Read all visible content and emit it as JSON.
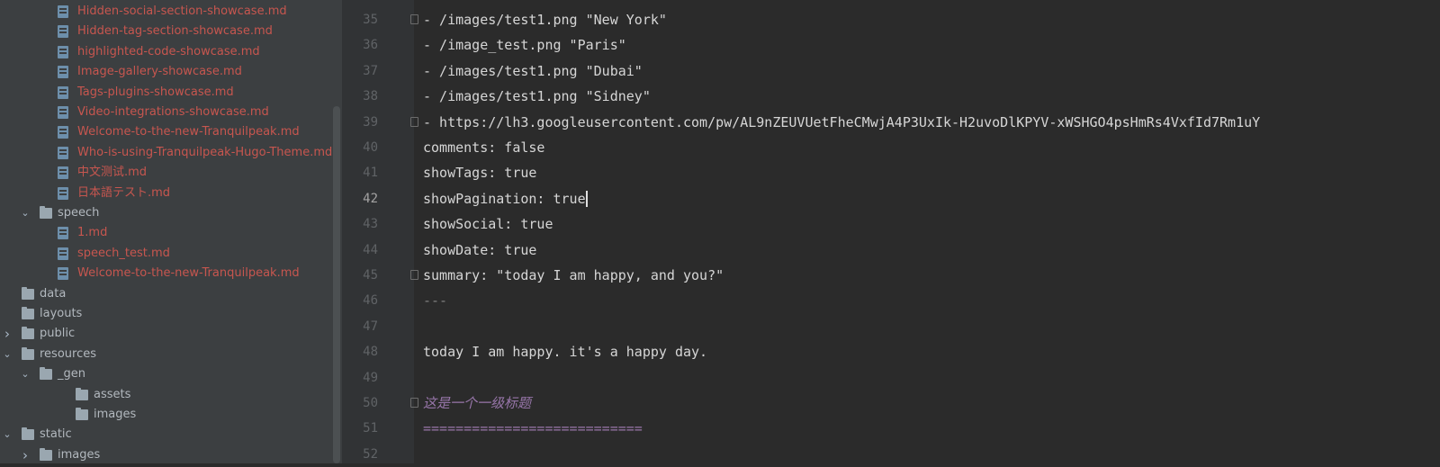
{
  "tree": {
    "items": [
      {
        "kind": "file",
        "depth": 2,
        "label": "Hidden-social-section-showcase.md"
      },
      {
        "kind": "file",
        "depth": 2,
        "label": "Hidden-tag-section-showcase.md"
      },
      {
        "kind": "file",
        "depth": 2,
        "label": "highlighted-code-showcase.md"
      },
      {
        "kind": "file",
        "depth": 2,
        "label": "Image-gallery-showcase.md"
      },
      {
        "kind": "file",
        "depth": 2,
        "label": "Tags-plugins-showcase.md"
      },
      {
        "kind": "file",
        "depth": 2,
        "label": "Video-integrations-showcase.md"
      },
      {
        "kind": "file",
        "depth": 2,
        "label": "Welcome-to-the-new-Tranquilpeak.md"
      },
      {
        "kind": "file",
        "depth": 2,
        "label": "Who-is-using-Tranquilpeak-Hugo-Theme.md"
      },
      {
        "kind": "file",
        "depth": 2,
        "label": "中文测试.md"
      },
      {
        "kind": "file",
        "depth": 2,
        "label": "日本語テスト.md"
      },
      {
        "kind": "dir",
        "depth": 1,
        "state": "expanded",
        "label": "speech"
      },
      {
        "kind": "file",
        "depth": 2,
        "label": "1.md"
      },
      {
        "kind": "file",
        "depth": 2,
        "label": "speech_test.md"
      },
      {
        "kind": "file",
        "depth": 2,
        "label": "Welcome-to-the-new-Tranquilpeak.md"
      },
      {
        "kind": "dir",
        "depth": 0,
        "state": "leaf",
        "label": "data"
      },
      {
        "kind": "dir",
        "depth": 0,
        "state": "leaf",
        "label": "layouts"
      },
      {
        "kind": "dir",
        "depth": 0,
        "state": "collapsed",
        "label": "public"
      },
      {
        "kind": "dir",
        "depth": 0,
        "state": "expanded",
        "label": "resources"
      },
      {
        "kind": "dir",
        "depth": 1,
        "state": "expanded",
        "label": "_gen"
      },
      {
        "kind": "dir",
        "depth": 2,
        "state": "leaf",
        "label": "assets"
      },
      {
        "kind": "dir",
        "depth": 2,
        "state": "leaf",
        "label": "images"
      },
      {
        "kind": "dir",
        "depth": 0,
        "state": "expanded",
        "label": "static"
      },
      {
        "kind": "dir",
        "depth": 1,
        "state": "collapsed",
        "label": "images"
      }
    ]
  },
  "editor": {
    "lines": [
      {
        "num": "35",
        "text": "- /images/test1.png \"New York\"",
        "fold": true
      },
      {
        "num": "36",
        "text": "- /image_test.png \"Paris\""
      },
      {
        "num": "37",
        "text": "- /images/test1.png \"Dubai\""
      },
      {
        "num": "38",
        "text": "- /images/test1.png \"Sidney\""
      },
      {
        "num": "39",
        "text": "- https://lh3.googleusercontent.com/pw/AL9nZEUVUetFheCMwjA4P3UxIk-H2uvoDlKPYV-xWSHGO4psHmRs4VxfId7Rm1uY",
        "fold": true
      },
      {
        "num": "40",
        "text": "comments: false"
      },
      {
        "num": "41",
        "text": "showTags: true"
      },
      {
        "num": "42",
        "text": "showPagination: true",
        "current": true
      },
      {
        "num": "43",
        "text": "showSocial: true"
      },
      {
        "num": "44",
        "text": "showDate: true"
      },
      {
        "num": "45",
        "text": "summary: \"today I am happy, and you?\"",
        "fold": true
      },
      {
        "num": "46",
        "text": "---",
        "style": "dashes"
      },
      {
        "num": "47",
        "text": ""
      },
      {
        "num": "48",
        "text": "today I am happy. it's a happy day."
      },
      {
        "num": "49",
        "text": ""
      },
      {
        "num": "50",
        "text": "这是一个一级标题",
        "style": "heading",
        "fold": true
      },
      {
        "num": "51",
        "text": "===========================",
        "style": "ruler"
      },
      {
        "num": "52",
        "text": ""
      }
    ]
  },
  "colors": {
    "tree_bg": "#3c3f41",
    "editor_bg": "#2b2b2b",
    "modified_file": "#c7564f",
    "folder_label": "#b2b8be",
    "markdown_heading": "#9876aa"
  }
}
